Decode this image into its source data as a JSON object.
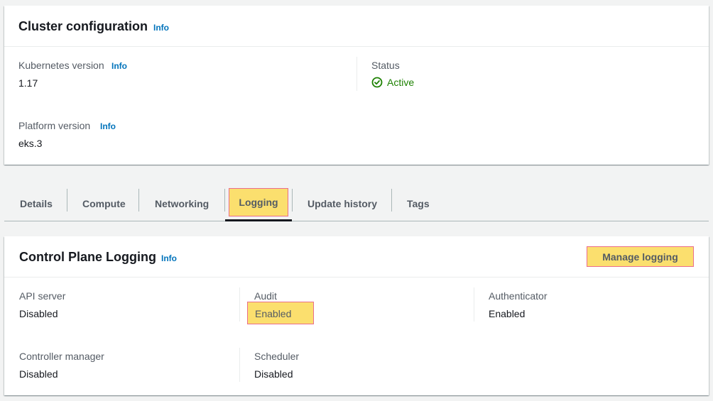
{
  "cluster_config": {
    "title": "Cluster configuration",
    "info": "Info",
    "kubernetes_version": {
      "label": "Kubernetes version",
      "info": "Info",
      "value": "1.17"
    },
    "platform_version": {
      "label": "Platform version",
      "info": "Info",
      "value": "eks.3"
    },
    "status": {
      "label": "Status",
      "value": "Active",
      "icon": "check-circle-icon",
      "color": "#1d8102"
    }
  },
  "tabs": [
    {
      "label": "Details"
    },
    {
      "label": "Compute"
    },
    {
      "label": "Networking"
    },
    {
      "label": "Logging",
      "selected": true
    },
    {
      "label": "Update history"
    },
    {
      "label": "Tags"
    }
  ],
  "control_plane_logging": {
    "title": "Control Plane Logging",
    "info": "Info",
    "manage_button": "Manage logging",
    "items": [
      {
        "label": "API server",
        "value": "Disabled"
      },
      {
        "label": "Audit",
        "value": "Enabled"
      },
      {
        "label": "Authenticator",
        "value": "Enabled"
      },
      {
        "label": "Controller manager",
        "value": "Disabled"
      },
      {
        "label": "Scheduler",
        "value": "Disabled"
      }
    ]
  },
  "colors": {
    "highlight": "#fbdf6e",
    "highlight_border": "#ea6d8b",
    "link": "#0073bb",
    "success": "#1d8102"
  }
}
